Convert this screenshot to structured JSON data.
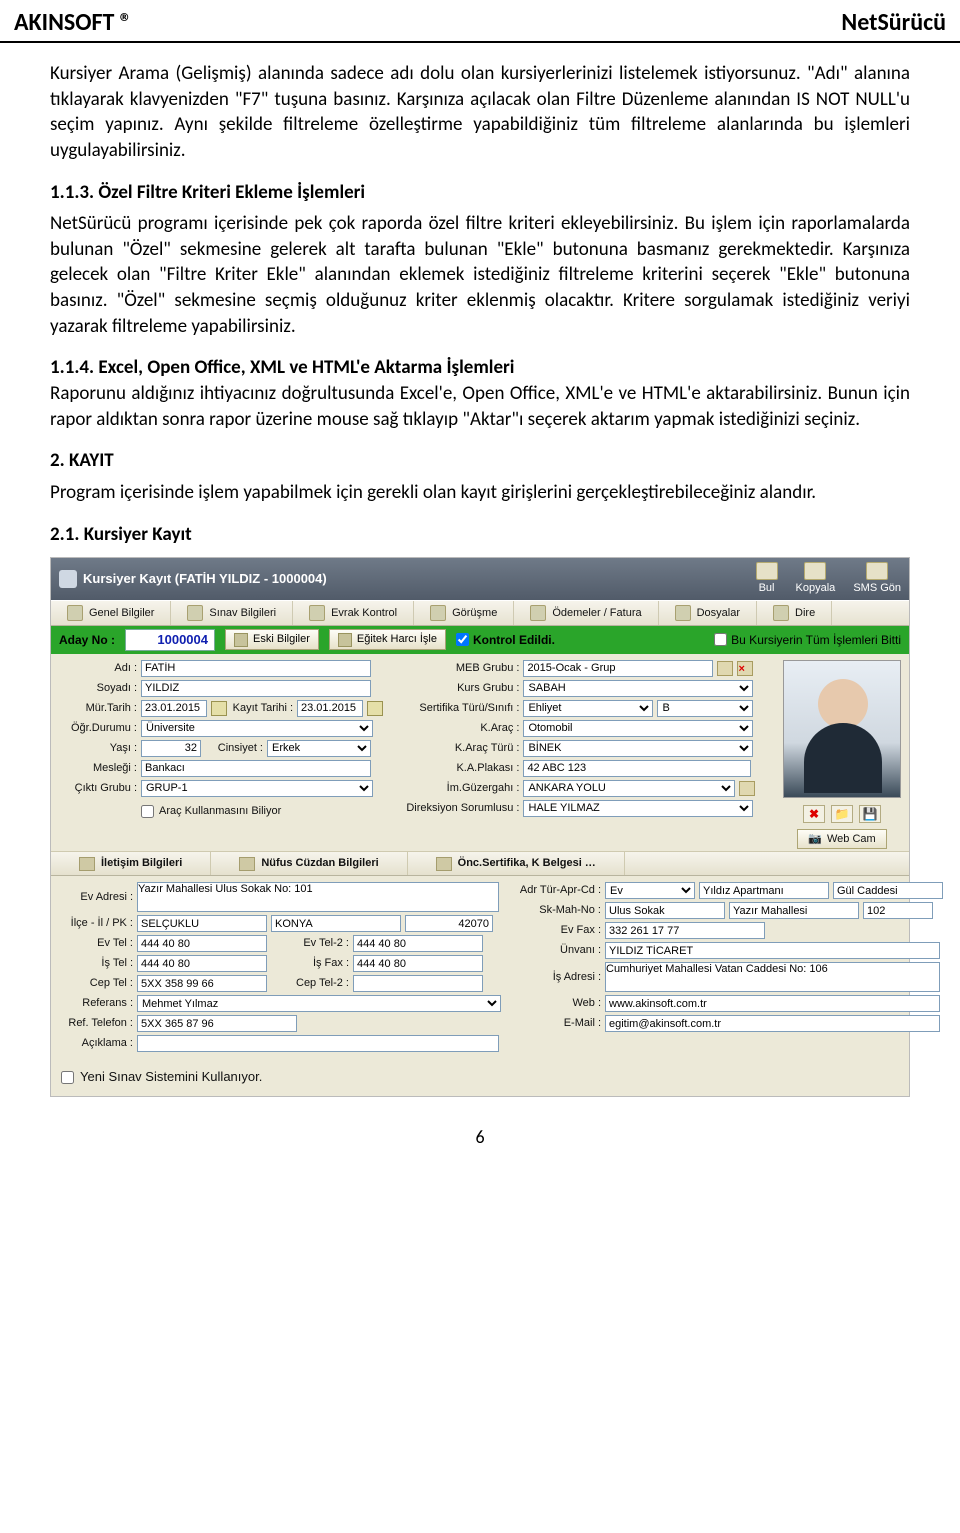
{
  "header": {
    "brand": "AKINSOFT ®",
    "product": "NetSürücü"
  },
  "doc": {
    "p1": "Kursiyer Arama (Gelişmiş) alanında sadece adı dolu olan kursiyerlerinizi listelemek istiyorsunuz. \"Adı\" alanına tıklayarak klavyenizden \"F7\" tuşuna basınız. Karşınıza açılacak olan Filtre Düzenleme alanından IS NOT NULL'u seçim yapınız. Aynı şekilde filtreleme özelleştirme yapabildiğiniz tüm filtreleme alanlarında bu işlemleri uygulayabilirsiniz.",
    "h113": "1.1.3. Özel Filtre Kriteri Ekleme İşlemleri",
    "p2": "NetSürücü programı içerisinde pek çok raporda özel filtre kriteri ekleyebilirsiniz. Bu işlem için raporlamalarda bulunan \"Özel\" sekmesine gelerek alt tarafta bulunan \"Ekle\" butonuna basmanız gerekmektedir. Karşınıza gelecek olan \"Filtre Kriter Ekle\" alanından eklemek istediğiniz filtreleme kriterini seçerek \"Ekle\" butonuna basınız. \"Özel\" sekmesine seçmiş olduğunuz kriter eklenmiş olacaktır. Kritere sorgulamak istediğiniz veriyi yazarak filtreleme yapabilirsiniz.",
    "h114": "1.1.4. Excel, Open Office, XML ve HTML'e Aktarma İşlemleri",
    "p3": "Raporunu aldığınız ihtiyacınız doğrultusunda  Excel'e, Open Office, XML'e ve HTML'e aktarabilirsiniz. Bunun için rapor aldıktan sonra rapor üzerine mouse sağ tıklayıp \"Aktar\"ı seçerek aktarım yapmak istediğinizi seçiniz.",
    "h2": "2.   KAYIT",
    "p4": "Program içerisinde işlem yapabilmek için gerekli olan kayıt girişlerini gerçekleştirebileceğiniz alandır.",
    "h21": "2.1. Kursiyer Kayıt",
    "pagenum": "6"
  },
  "app": {
    "title": "Kursiyer Kayıt (FATİH YILDIZ - 1000004)",
    "topButtons": {
      "bul": "Bul",
      "kopyala": "Kopyala",
      "sms": "SMS Gön"
    },
    "tabs": {
      "genel": "Genel Bilgiler",
      "sinav": "Sınav Bilgileri",
      "evrak": "Evrak Kontrol",
      "gorusme": "Görüşme",
      "odeme": "Ödemeler / Fatura",
      "dosya": "Dosyalar",
      "dire": "Dire"
    },
    "greenbar": {
      "adayLabel": "Aday No :",
      "adayVal": "1000004",
      "eskiBtn": "Eski Bilgiler",
      "egitekBtn": "Eğitek Harcı İşle",
      "kontrolChk": "Kontrol Edildi.",
      "tumIslemChk": "Bu Kursiyerin Tüm İşlemleri Bitti"
    },
    "left": {
      "adiLbl": "Adı :",
      "adi": "FATİH",
      "soyadiLbl": "Soyadı :",
      "soyadi": "YILDIZ",
      "murLbl": "Mür.Tarih :",
      "mur": "23.01.2015",
      "kayitTarihiLbl": "Kayıt Tarihi :",
      "kayitTarihi": "23.01.2015",
      "ogrDurLbl": "Öğr.Durumu :",
      "ogrDur": "Üniversite",
      "yasiLbl": "Yaşı :",
      "yasi": "32",
      "cinsiyetLbl": "Cinsiyet :",
      "cinsiyet": "Erkek",
      "meslekLbl": "Mesleği :",
      "meslek": "Bankacı",
      "ciktiLbl": "Çıktı Grubu :",
      "cikti": "GRUP-1",
      "aracChk": "Araç Kullanmasını Biliyor"
    },
    "mid": {
      "mebLbl": "MEB Grubu :",
      "meb": "2015-Ocak - Grup",
      "kursLbl": "Kurs Grubu :",
      "kurs": "SABAH",
      "sertLbl": "Sertifika Türü/Sınıfı :",
      "sert": "Ehliyet",
      "sertClass": "B",
      "karacLbl": "K.Araç :",
      "karac": "Otomobil",
      "karacTurLbl": "K.Araç Türü :",
      "karacTur": "BİNEK",
      "plakaLbl": "K.A.Plakası :",
      "plaka": "42 ABC 123",
      "guzLbl": "İm.Güzergahı :",
      "guz": "ANKARA YOLU",
      "dirSorLbl": "Direksiyon Sorumlusu :",
      "dirSor": "HALE YILMAZ"
    },
    "photo": {
      "webcamBtn": "Web Cam"
    },
    "subtabs": {
      "iletisim": "İletişim Bilgileri",
      "nufus": "Nüfus Cüzdan Bilgileri",
      "onc": "Önc.Sertifika, K Belgesi …"
    },
    "contactL": {
      "evAdrLbl": "Ev Adresi :",
      "evAdr": "Yazır Mahallesi Ulus Sokak No: 101",
      "ilceLbl": "İlçe - İl / PK :",
      "ilce": "SELÇUKLU",
      "il": "KONYA",
      "pk": "42070",
      "evTelLbl": "Ev Tel :",
      "evTel": "444 40 80",
      "evTel2Lbl": "Ev Tel-2 :",
      "evTel2": "444 40 80",
      "isTelLbl": "İş Tel :",
      "isTel": "444 40 80",
      "isFaxLbl": "İş Fax :",
      "isFax": "444 40 80",
      "cepTelLbl": "Cep Tel :",
      "cepTel": "5XX 358 99 66",
      "cepTel2Lbl": "Cep Tel-2 :",
      "cepTel2": "",
      "refLbl": "Referans :",
      "ref": "Mehmet Yılmaz",
      "refTelLbl": "Ref. Telefon :",
      "refTel": "5XX 365 87 96",
      "aciklamaLbl": "Açıklama :",
      "aciklama": ""
    },
    "contactR": {
      "adrTurLbl": "Adr Tür-Apr-Cd :",
      "adrTur": "Ev",
      "apt": "Yıldız Apartmanı",
      "cad": "Gül Caddesi",
      "skMahLbl": "Sk-Mah-No :",
      "sk": "Ulus Sokak",
      "mah": "Yazır Mahallesi",
      "no": "102",
      "evFaxLbl": "Ev Fax :",
      "evFax": "332 261 17 77",
      "unvanLbl": "Ünvanı :",
      "unvan": "YILDIZ TİCARET",
      "isAdrLbl": "İş Adresi :",
      "isAdr": "Cumhuriyet Mahallesi Vatan Caddesi No: 106",
      "webLbl": "Web :",
      "web": "www.akinsoft.com.tr",
      "emailLbl": "E-Mail :",
      "email": "egitim@akinsoft.com.tr"
    },
    "finalChk": "Yeni Sınav Sistemini Kullanıyor."
  }
}
